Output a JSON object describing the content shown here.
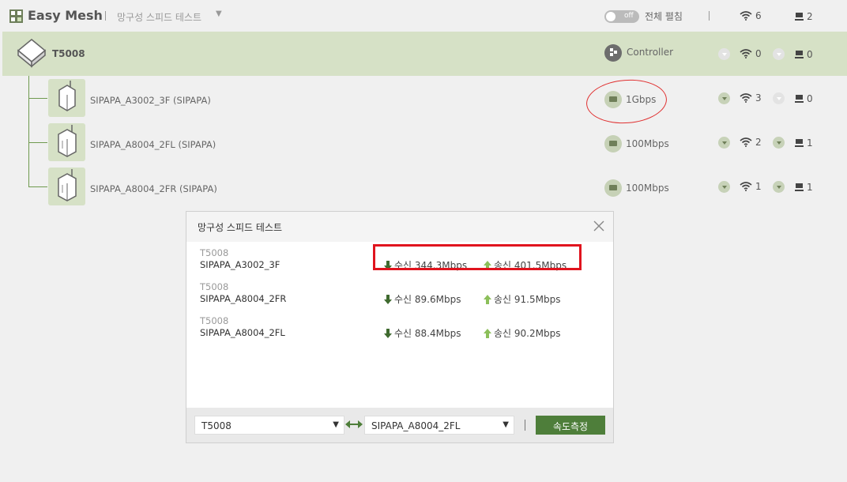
{
  "header": {
    "app_title": "Easy Mesh",
    "menu_label": "망구성 스피드 테스트",
    "menu_caret": "▼",
    "toggle_state": "off",
    "toggle_label": "전체 펼침",
    "wifi_total": "6",
    "wired_total": "2"
  },
  "controller": {
    "name": "T5008",
    "role": "Controller",
    "wifi_count": "0",
    "wired_count": "0"
  },
  "nodes": [
    {
      "name": "SIPAPA_A3002_3F  (SIPAPA)",
      "speed": "1Gbps",
      "wifi_count": "3",
      "wired_count": "0"
    },
    {
      "name": "SIPAPA_A8004_2FL  (SIPAPA)",
      "speed": "100Mbps",
      "wifi_count": "2",
      "wired_count": "1"
    },
    {
      "name": "SIPAPA_A8004_2FR  (SIPAPA)",
      "speed": "100Mbps",
      "wifi_count": "1",
      "wired_count": "1"
    }
  ],
  "dialog": {
    "title": "망구성 스피드 테스트",
    "results": [
      {
        "source": "T5008",
        "target": "SIPAPA_A3002_3F",
        "rx": "수신 344.3Mbps",
        "tx": "송신 401.5Mbps"
      },
      {
        "source": "T5008",
        "target": "SIPAPA_A8004_2FR",
        "rx": "수신  89.6Mbps",
        "tx": "송신  91.5Mbps"
      },
      {
        "source": "T5008",
        "target": "SIPAPA_A8004_2FL",
        "rx": "수신  88.4Mbps",
        "tx": "송신  90.2Mbps"
      }
    ],
    "source_select": "T5008",
    "target_select": "SIPAPA_A8004_2FL",
    "select_caret": "▼",
    "measure_button": "속도측정"
  },
  "colors": {
    "accent_green": "#4e7e3a",
    "row_highlight": "#d6e1c6",
    "annotation_red": "#e0141e"
  }
}
